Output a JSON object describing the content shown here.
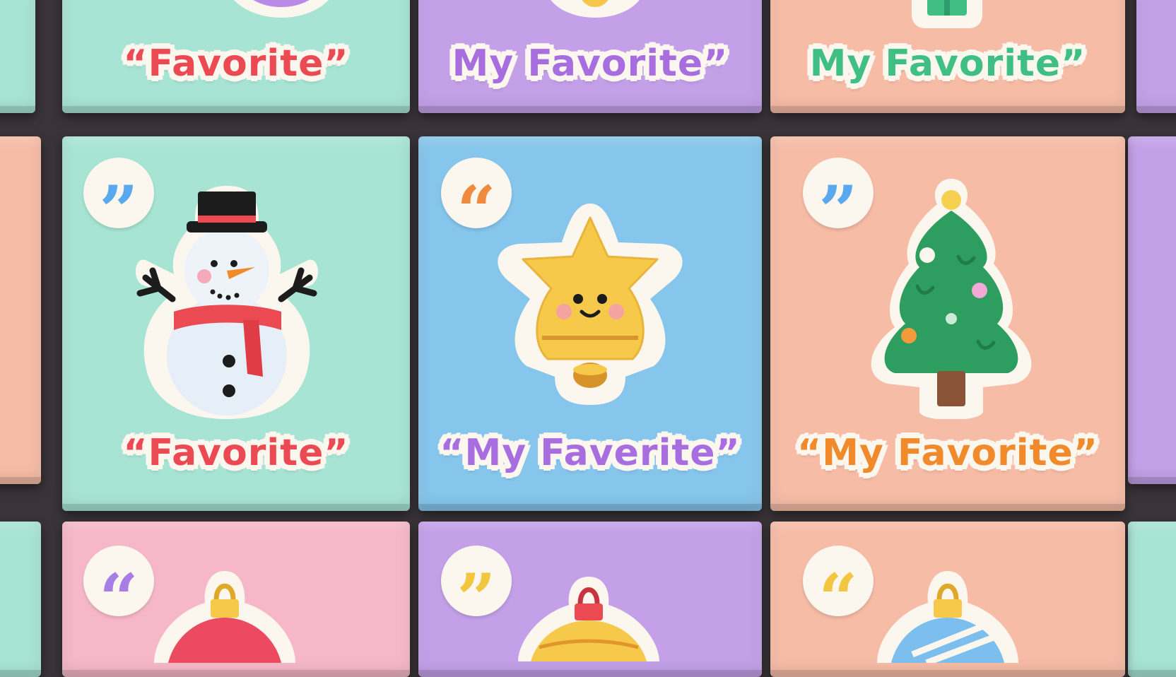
{
  "colors": {
    "mint": "#a8e4d4",
    "lavender": "#c3a0e8",
    "peach": "#f6bca6",
    "sky": "#86c6ec",
    "pink": "#f6b8c8",
    "cream": "#fbf6ee"
  },
  "tiles": {
    "top_left": {
      "label": "“Favorite”",
      "label_color": "#ec4a52"
    },
    "top_middle": {
      "label": "My Favorite”",
      "label_color": "#a86ee0"
    },
    "top_right": {
      "label": "My Favorite”",
      "label_color": "#3fbf84"
    },
    "mid_left": {
      "quote": "”",
      "quote_color": "#5aa9ef",
      "label": "“Favorite”",
      "label_color": "#ec4a52",
      "icon": "snowman-icon"
    },
    "mid_middle": {
      "quote": "“",
      "quote_color": "#f08a3c",
      "label": "“My Faverite”",
      "label_color": "#a86ee0",
      "icon": "star-bell-icon"
    },
    "mid_right": {
      "quote": "”",
      "quote_color": "#5aa9ef",
      "label": "“My Favorite”",
      "label_color": "#f08a2a",
      "icon": "christmas-tree-icon"
    },
    "bottom_left": {
      "quote": "“",
      "quote_color": "#a77ee6",
      "icon": "ornament-icon"
    },
    "bottom_middle": {
      "quote": "”",
      "quote_color": "#f3c640",
      "icon": "ornament-icon"
    },
    "bottom_right": {
      "quote": "“",
      "quote_color": "#f3c640",
      "icon": "ornament-icon"
    }
  }
}
